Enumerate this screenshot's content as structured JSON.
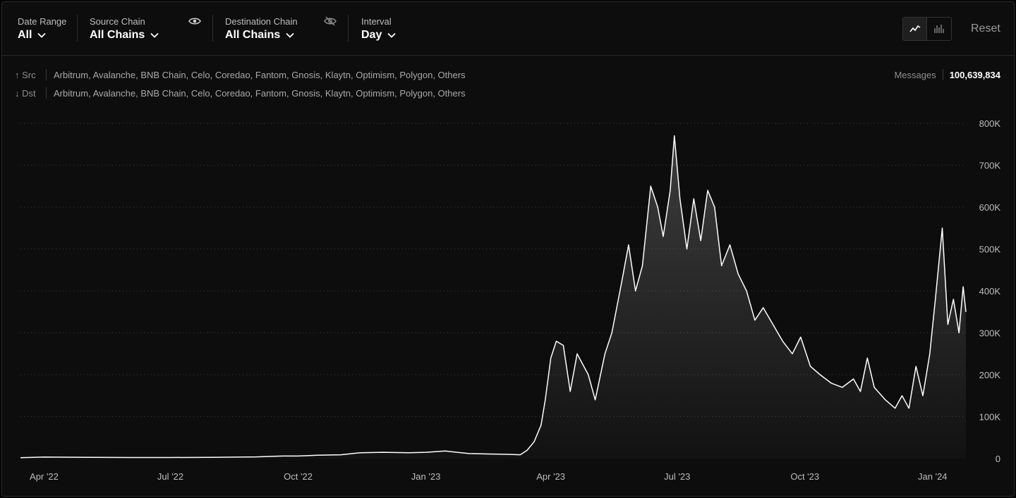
{
  "filters": {
    "date_range": {
      "label": "Date Range",
      "value": "All"
    },
    "source_chain": {
      "label": "Source Chain",
      "value": "All Chains"
    },
    "destination_chain": {
      "label": "Destination Chain",
      "value": "All Chains"
    },
    "interval": {
      "label": "Interval",
      "value": "Day"
    }
  },
  "toolbar": {
    "reset_label": "Reset"
  },
  "legend": {
    "src_label": "↑ Src",
    "src_chains": "Arbitrum, Avalanche, BNB Chain, Celo, Coredao, Fantom, Gnosis, Klaytn, Optimism, Polygon, Others",
    "dst_label": "↓ Dst",
    "dst_chains": "Arbitrum, Avalanche, BNB Chain, Celo, Coredao, Fantom, Gnosis, Klaytn, Optimism, Polygon, Others"
  },
  "summary": {
    "label": "Messages",
    "value": "100,639,834"
  },
  "colors": {
    "line": "#ffffff",
    "grid": "#3a3a3a",
    "background": "#0d0d0d"
  },
  "chart_data": {
    "type": "area",
    "title": "",
    "xlabel": "",
    "ylabel": "",
    "x_range": [
      "2022-03-15",
      "2024-01-25"
    ],
    "ylim": [
      0,
      800000
    ],
    "y_ticks": [
      0,
      100000,
      200000,
      300000,
      400000,
      500000,
      600000,
      700000,
      800000
    ],
    "y_tick_labels": [
      "0",
      "100K",
      "200K",
      "300K",
      "400K",
      "500K",
      "600K",
      "700K",
      "800K"
    ],
    "x_ticks": [
      "2022-04-01",
      "2022-07-01",
      "2022-10-01",
      "2023-01-01",
      "2023-04-01",
      "2023-07-01",
      "2023-10-01",
      "2024-01-01"
    ],
    "x_tick_labels": [
      "Apr '22",
      "Jul '22",
      "Oct '22",
      "Jan '23",
      "Apr '23",
      "Jul '23",
      "Oct '23",
      "Jan '24"
    ],
    "grid": true,
    "y_axis_side": "right",
    "series": [
      {
        "points": [
          [
            "2022-03-15",
            2000
          ],
          [
            "2022-04-01",
            3500
          ],
          [
            "2022-05-01",
            3000
          ],
          [
            "2022-06-01",
            2500
          ],
          [
            "2022-07-01",
            2500
          ],
          [
            "2022-08-01",
            3000
          ],
          [
            "2022-09-01",
            4000
          ],
          [
            "2022-09-20",
            6000
          ],
          [
            "2022-10-01",
            6000
          ],
          [
            "2022-10-15",
            8000
          ],
          [
            "2022-11-01",
            9000
          ],
          [
            "2022-11-15",
            14000
          ],
          [
            "2022-12-01",
            15000
          ],
          [
            "2022-12-20",
            14000
          ],
          [
            "2023-01-01",
            15000
          ],
          [
            "2023-01-15",
            18000
          ],
          [
            "2023-02-01",
            12000
          ],
          [
            "2023-02-15",
            11000
          ],
          [
            "2023-03-01",
            10000
          ],
          [
            "2023-03-10",
            9000
          ],
          [
            "2023-03-15",
            20000
          ],
          [
            "2023-03-20",
            40000
          ],
          [
            "2023-03-25",
            80000
          ],
          [
            "2023-03-28",
            140000
          ],
          [
            "2023-04-01",
            240000
          ],
          [
            "2023-04-05",
            280000
          ],
          [
            "2023-04-10",
            270000
          ],
          [
            "2023-04-15",
            160000
          ],
          [
            "2023-04-20",
            250000
          ],
          [
            "2023-04-28",
            200000
          ],
          [
            "2023-05-03",
            140000
          ],
          [
            "2023-05-10",
            250000
          ],
          [
            "2023-05-15",
            300000
          ],
          [
            "2023-05-22",
            420000
          ],
          [
            "2023-05-27",
            510000
          ],
          [
            "2023-06-01",
            400000
          ],
          [
            "2023-06-06",
            460000
          ],
          [
            "2023-06-12",
            650000
          ],
          [
            "2023-06-17",
            600000
          ],
          [
            "2023-06-21",
            530000
          ],
          [
            "2023-06-26",
            640000
          ],
          [
            "2023-06-29",
            770000
          ],
          [
            "2023-07-03",
            620000
          ],
          [
            "2023-07-08",
            500000
          ],
          [
            "2023-07-13",
            620000
          ],
          [
            "2023-07-18",
            520000
          ],
          [
            "2023-07-23",
            640000
          ],
          [
            "2023-07-28",
            600000
          ],
          [
            "2023-08-02",
            460000
          ],
          [
            "2023-08-08",
            510000
          ],
          [
            "2023-08-14",
            440000
          ],
          [
            "2023-08-20",
            400000
          ],
          [
            "2023-08-26",
            330000
          ],
          [
            "2023-09-01",
            360000
          ],
          [
            "2023-09-08",
            320000
          ],
          [
            "2023-09-15",
            280000
          ],
          [
            "2023-09-22",
            250000
          ],
          [
            "2023-09-28",
            290000
          ],
          [
            "2023-10-05",
            220000
          ],
          [
            "2023-10-12",
            200000
          ],
          [
            "2023-10-20",
            180000
          ],
          [
            "2023-10-28",
            170000
          ],
          [
            "2023-11-05",
            190000
          ],
          [
            "2023-11-10",
            160000
          ],
          [
            "2023-11-15",
            240000
          ],
          [
            "2023-11-20",
            170000
          ],
          [
            "2023-11-28",
            140000
          ],
          [
            "2023-12-05",
            120000
          ],
          [
            "2023-12-10",
            150000
          ],
          [
            "2023-12-15",
            120000
          ],
          [
            "2023-12-20",
            220000
          ],
          [
            "2023-12-25",
            150000
          ],
          [
            "2023-12-30",
            250000
          ],
          [
            "2024-01-03",
            380000
          ],
          [
            "2024-01-08",
            550000
          ],
          [
            "2024-01-12",
            320000
          ],
          [
            "2024-01-16",
            380000
          ],
          [
            "2024-01-20",
            300000
          ],
          [
            "2024-01-23",
            410000
          ],
          [
            "2024-01-25",
            350000
          ]
        ]
      }
    ]
  }
}
